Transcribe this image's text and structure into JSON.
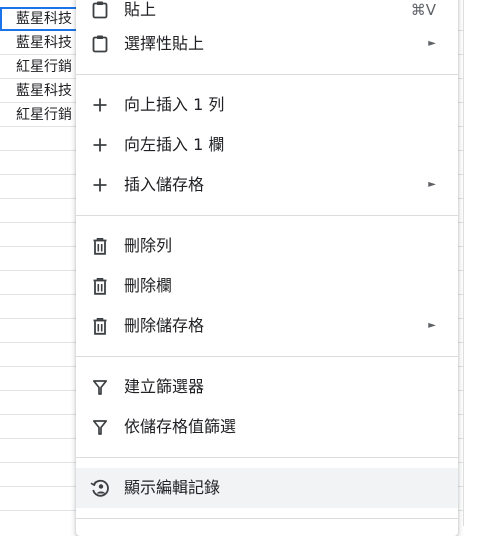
{
  "sheet": {
    "cells": [
      "藍星科技",
      "藍星科技",
      "紅星行銷",
      "藍星科技",
      "紅星行銷"
    ]
  },
  "menu": {
    "paste": {
      "label": "貼上",
      "shortcut": "⌘V",
      "icon": "clipboard-icon"
    },
    "paste_special": {
      "label": "選擇性貼上",
      "icon": "clipboard-icon"
    },
    "insert_row_above": {
      "label": "向上插入 1 列",
      "icon": "plus-icon"
    },
    "insert_col_left": {
      "label": "向左插入 1 欄",
      "icon": "plus-icon"
    },
    "insert_cells": {
      "label": "插入儲存格",
      "icon": "plus-icon"
    },
    "delete_row": {
      "label": "刪除列",
      "icon": "trash-icon"
    },
    "delete_col": {
      "label": "刪除欄",
      "icon": "trash-icon"
    },
    "delete_cells": {
      "label": "刪除儲存格",
      "icon": "trash-icon"
    },
    "create_filter": {
      "label": "建立篩選器",
      "icon": "filter-icon"
    },
    "filter_by_value": {
      "label": "依儲存格值篩選",
      "icon": "filter-icon"
    },
    "show_edit_history": {
      "label": "顯示編輯記錄",
      "icon": "history-icon"
    },
    "submenu_arrow": "►"
  }
}
